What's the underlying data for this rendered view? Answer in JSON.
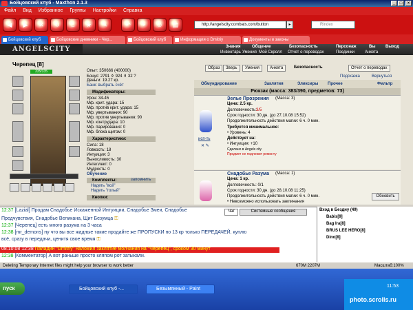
{
  "window": {
    "title": "Бойцовский клуб - Maxthon 2.1.3"
  },
  "menu": [
    "Файл",
    "Вид",
    "Избранное",
    "Группы",
    "Настройки",
    "Справка"
  ],
  "address": {
    "value": "http://angelscity.combats.com/button",
    "search_placeholder": "Rindex"
  },
  "tabs": [
    "Бойцовский клуб",
    "Бойцовские дневники - Чер...",
    "Бойцовский клуб",
    "Информация о Dmitriy",
    "Документы и законы"
  ],
  "logo": "ANGELSCITY",
  "topnav": {
    "row1": [
      "Знания",
      "Общение",
      "Безопасность",
      "Персонаж",
      "Вы",
      "Выход"
    ],
    "row2": [
      "Инвентарь",
      "Умения",
      "Мой Скролл",
      "Отчет о переводах",
      "Поединки",
      "Анкета"
    ]
  },
  "character": {
    "name": "Черепец [8]",
    "hp": "335/335"
  },
  "actions": [
    "Образ",
    "Зверь",
    "Умения",
    "Анкета",
    "Безопасность",
    "Отчет о переводах"
  ],
  "stats": [
    "Опыт: 350666 (400000)",
    "Бонус: 2791 ⚱ 924 ⚱ 32 ?",
    "Деньги: 19.27 кр.",
    "Банк: выбрать счёт"
  ],
  "mods_title": "Модификаторы:",
  "mods": [
    "Урон: 34-45",
    "Мф. крит. удара: 15",
    "Мф. против крит. удара: 15",
    "Мф. увертывания: 90",
    "Мф. против увертывания: 90",
    "Мф. контрудара: 10",
    "Мф. парирования: 0",
    "Мф. блока щитом: 0"
  ],
  "chars_title": "Характеристики:",
  "chars": [
    "Сила: 18",
    "Ловкость: 18",
    "Интуиция: 3",
    "Выносливость: 30",
    "Интеллект: 0",
    "Мудрость: 0"
  ],
  "chars_extra": [
    "Обучение"
  ],
  "kits_title": "Комплекты:",
  "kits_link": "запомнить",
  "kits": [
    "Надеть \"всё\"",
    "Надеть \"голый\""
  ],
  "buttons_title": "Кнопки:",
  "inv_tabs": [
    "Обмундирование",
    "Заклятия",
    "Эликсиры",
    "Прочее",
    "Фильтр"
  ],
  "inv_tools": [
    "Подсказка",
    "Вернуться"
  ],
  "inv_title": "Рюкзак (масса: 383/390, предметов: 73)",
  "items": [
    {
      "name": "Зелье Прозрения",
      "mass": "(Масса: 3)",
      "price": "Цена: 2.5 кр.",
      "dur_label": "Долговечность: ",
      "dur": "3/5",
      "exp": "Срок годности: 30 дн. (до 27.10.08 15:52)",
      "duration": "Продолжительность действия магии: 6 ч. 0 мин.",
      "req_title": "Требуется минимальное:",
      "req": "• Уровень: 4",
      "acts_title": "Действует на:",
      "acts": "• Интуиция: +10",
      "made": "Сделано в Angels city",
      "warn": "Предмет не подлежит ремонту",
      "use": "исп-ть"
    },
    {
      "name": "Снадобье Разума",
      "mass": "(Масса: 1)",
      "price": "Цена: 1 кр.",
      "dur": "Долговечность: 0/1",
      "exp": "Срок годности: 30 дн. (до 28.10.08 11:25)",
      "duration": "Продолжительность действия магии: 6 ч. 0 мин.",
      "extra": "• Невозможно использовать заклинания"
    }
  ],
  "chat": {
    "lines": [
      {
        "time": "12:37",
        "text": "[Lazial] Продам Снадобье Искаженной Интуиции, Снадобье Змеи, Снадобье"
      },
      {
        "time": "",
        "text": "Предчувствия, Снадобье Великана, Щит Безумца"
      },
      {
        "time": "12:37",
        "text": "[Черепец] есть много разума на 3 часа"
      },
      {
        "time": "12:38",
        "text": "[mr_demons] ну что вы все жадные такие продайте же ПРОПУСКИ по 13 кр только ПЕРЕДАЧЕЙ, куплю"
      },
      {
        "time": "",
        "text": "всё, сразу в передачи, ценитя свое время"
      },
      {
        "time": "08.10.08 12:38",
        "text": "Паладин \"Dmitriy\" наложил заклятие молчания на \"Черепец\", сроком 30 минут"
      },
      {
        "time": "12:38",
        "text": "[Комментатор] А вот раньше просто кляпом рот затыкали."
      }
    ],
    "tabs": [
      "Чат",
      "Системные сообщения"
    ]
  },
  "room": {
    "title": "Вход в Бездну (49)",
    "users": [
      "Babis[9]",
      "Bag Ira[8]",
      "BRUS LEE HERO[8]",
      "Dino[8]"
    ],
    "refresh": "Обновить"
  },
  "status": {
    "text": "Deleting Temporary Internet files might help your browser to work better",
    "mem": "670M 2207M",
    "zoom": "Масштаб:100%"
  },
  "taskbar": {
    "start": "пуск",
    "tasks": [
      "Бойцовский клуб -...",
      "Безымянный - Paint"
    ],
    "clock": "11:53",
    "watermark": "photo.scrolls.ru"
  }
}
